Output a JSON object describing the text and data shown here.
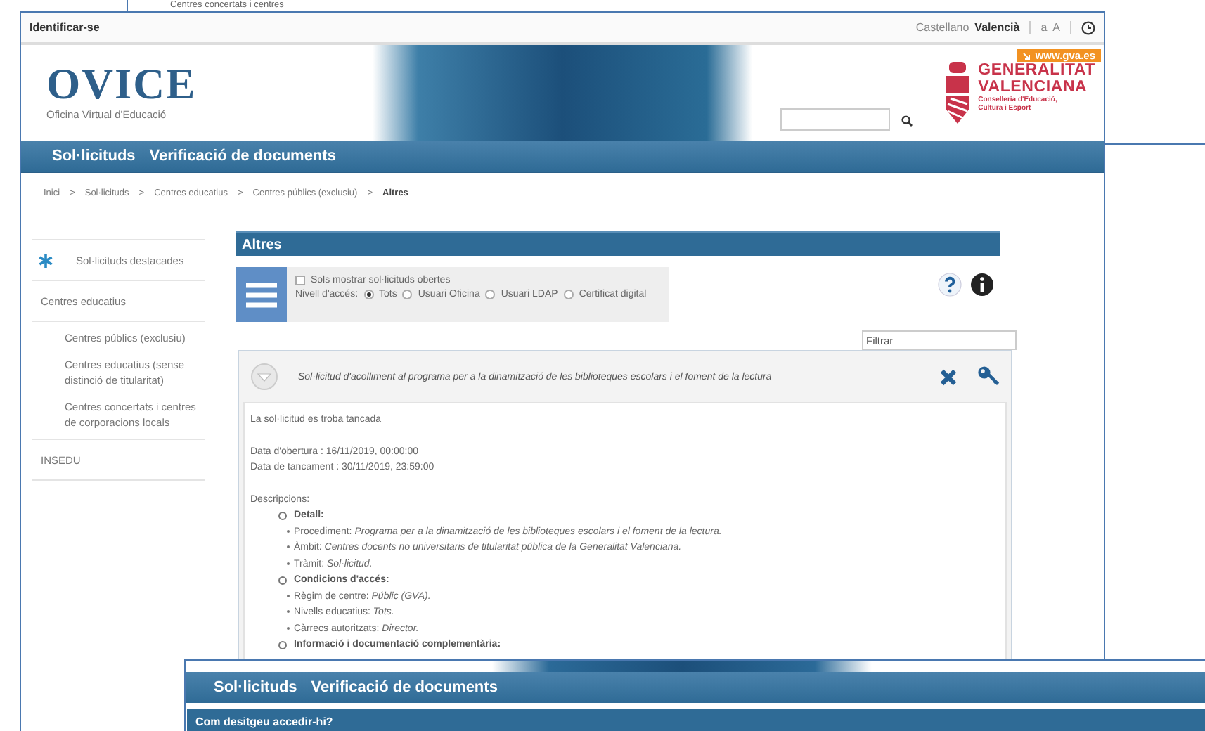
{
  "back_window": {
    "text": "Centres concertats i centres"
  },
  "top_bar": {
    "login": "Identificar-se",
    "languages": [
      {
        "label": "Castellano",
        "selected": false
      },
      {
        "label": "Valencià",
        "selected": true
      }
    ],
    "font_sizes": [
      "a",
      "A"
    ]
  },
  "header": {
    "logo_title": "OVICE",
    "logo_subtitle": "Oficina Virtual d'Educació",
    "gva_link": "www.gva.es",
    "gva_logo": {
      "title": [
        "GENERALITAT",
        "VALENCIANA"
      ],
      "subtitle": [
        "Conselleria d'Educació,",
        "Cultura i Esport"
      ]
    }
  },
  "nav": [
    "Sol·licituds",
    "Verificació de documents"
  ],
  "breadcrumb": [
    {
      "label": "Inici",
      "separator": ">",
      "current": false
    },
    {
      "label": "Sol·licituds",
      "separator": ">",
      "current": false
    },
    {
      "label": "Centres educatius",
      "separator": ">",
      "current": false
    },
    {
      "label": "Centres públics (exclusiu)",
      "separator": ">",
      "current": false
    },
    {
      "label": "Altres",
      "current": true
    }
  ],
  "sidebar": {
    "items": [
      {
        "label": "Sol·licituds destacades",
        "kind": "featured"
      },
      {
        "label": "Centres educatius",
        "kind": "plain",
        "children": [
          {
            "label": "Centres públics (exclusiu)"
          },
          {
            "label": "Centres educatius (sense distinció de titularitat)"
          },
          {
            "label": "Centres concertats i centres de corporacions locals"
          }
        ]
      },
      {
        "label": "INSEDU",
        "kind": "plain"
      }
    ]
  },
  "section_title": "Altres",
  "filters": {
    "open_only": {
      "label": "Sols mostrar sol·licituds obertes",
      "checked": false
    },
    "access_label": "Nivell d'accés:",
    "access_levels": [
      {
        "label": "Tots",
        "selected": true
      },
      {
        "label": "Usuari Oficina",
        "selected": false
      },
      {
        "label": "Usuari LDAP",
        "selected": false
      },
      {
        "label": "Certificat digital",
        "selected": false
      }
    ]
  },
  "filter_field": {
    "placeholder": "Filtrar"
  },
  "request": {
    "title": "Sol·licitud d'acolliment al programa per a la dinamització de les biblioteques escolars i el foment de la lectura",
    "status": "La sol·licitud es troba tancada",
    "dates": [
      "Data d'obertura : 16/11/2019, 00:00:00",
      "Data de tancament : 30/11/2019, 23:59:00"
    ],
    "descriptions_label": "Descripcions:",
    "sections": [
      {
        "title": "Detall:",
        "items": [
          {
            "label": "Procediment:",
            "value": "Programa per a la dinamització de les biblioteques escolars i el foment de la lectura."
          },
          {
            "label": "Àmbit:",
            "value": "Centres docents no universitaris de titularitat pública de la Generalitat Valenciana."
          },
          {
            "label": "Tràmit:",
            "value": "Sol·licitud."
          }
        ]
      },
      {
        "title": "Condicions d'accés:",
        "items": [
          {
            "label": "Règim de centre:",
            "value": "Públic (GVA)."
          },
          {
            "label": "Nivells educatius:",
            "value": "Tots."
          },
          {
            "label": "Càrrecs autoritzats:",
            "value": "Director."
          }
        ]
      },
      {
        "title": "Informació i documentació complementària:"
      }
    ]
  },
  "front_window": {
    "nav": [
      "Sol·licituds",
      "Verificació de documents"
    ],
    "bar_title": "Com desitgeu accedir-hi?"
  }
}
